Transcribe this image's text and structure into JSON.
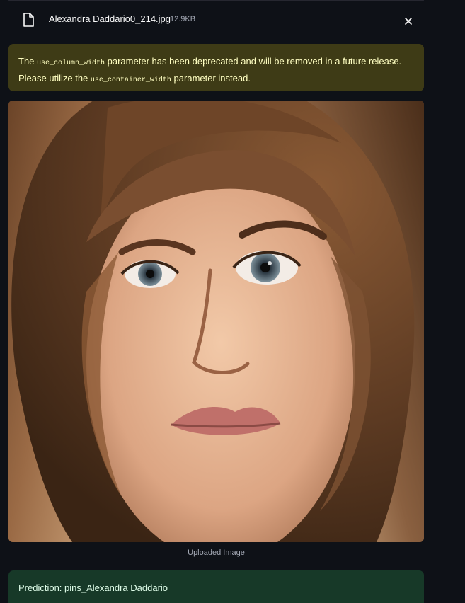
{
  "file": {
    "name": "Alexandra Daddario0_214.jpg",
    "size": "12.9KB",
    "icon": "file-icon",
    "close_icon": "close-icon"
  },
  "warning": {
    "prefix": "The ",
    "code1": "use_column_width",
    "middle": " parameter has been deprecated and will be removed in a future release. Please utilize the ",
    "code2": "use_container_width",
    "suffix": " parameter instead."
  },
  "image": {
    "caption": "Uploaded Image"
  },
  "result": {
    "text": "Prediction: pins_Alexandra Daddario"
  },
  "colors": {
    "background": "#0e1117",
    "warning_bg": "#3e3b16",
    "warning_text": "#ffffc2",
    "success_bg": "#173928",
    "success_text": "#dffde9"
  }
}
